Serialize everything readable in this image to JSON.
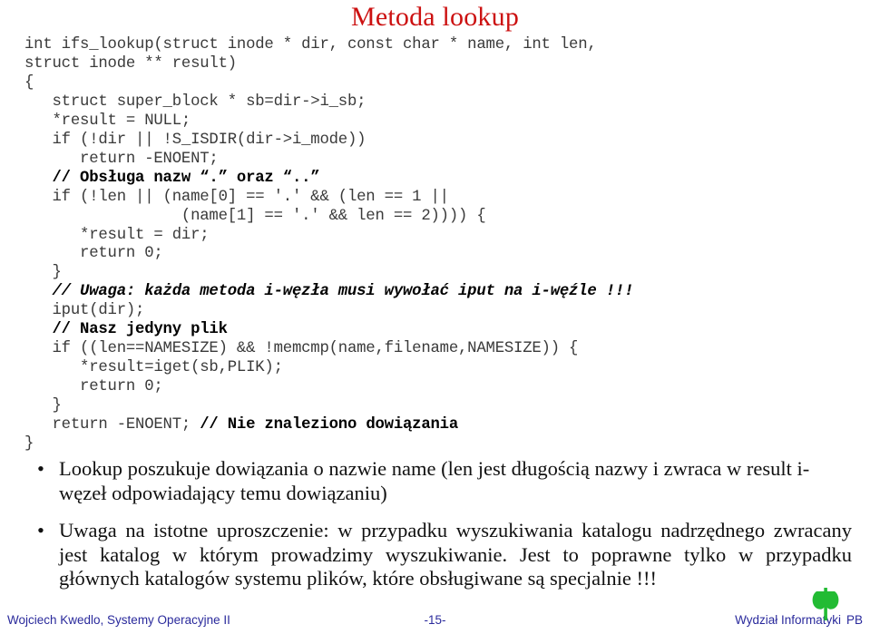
{
  "slide": {
    "title": "Metoda lookup",
    "title_color": "#CC1111",
    "bullet_glyph": "•"
  },
  "code": {
    "lines": [
      {
        "text": "int ifs_lookup(struct inode * dir, const char * name, int len,",
        "style": "plain"
      },
      {
        "text": "struct inode ** result)",
        "style": "plain"
      },
      {
        "text": "{",
        "style": "plain"
      },
      {
        "text": "   struct super_block * sb=dir->i_sb;",
        "style": "plain"
      },
      {
        "text": "   *result = NULL;",
        "style": "plain"
      },
      {
        "text": "   if (!dir || !S_ISDIR(dir->i_mode))",
        "style": "plain"
      },
      {
        "text": "      return -ENOENT;",
        "style": "plain"
      },
      {
        "text": "   // Obsługa nazw “.” oraz “..”",
        "style": "comment"
      },
      {
        "text": "   if (!len || (name[0] == '.' && (len == 1 ||",
        "style": "plain"
      },
      {
        "text": "                 (name[1] == '.' && len == 2)))) {",
        "style": "plain"
      },
      {
        "text": "      *result = dir;",
        "style": "plain"
      },
      {
        "text": "      return 0;",
        "style": "plain"
      },
      {
        "text": "   }",
        "style": "plain"
      },
      {
        "text": "   // Uwaga: każda metoda i-węzła musi wywołać iput na i-węźle !!!",
        "style": "comment-italic"
      },
      {
        "text": "   iput(dir);",
        "style": "plain"
      },
      {
        "text": "   // Nasz jedyny plik",
        "style": "comment"
      },
      {
        "text": "   if ((len==NAMESIZE) && !memcmp(name,filename,NAMESIZE)) {",
        "style": "plain"
      },
      {
        "text": "      *result=iget(sb,PLIK);",
        "style": "plain"
      },
      {
        "text": "      return 0;",
        "style": "plain"
      },
      {
        "text": "   }",
        "style": "plain"
      },
      {
        "text": "   return -ENOENT; ",
        "style": "plain",
        "tail": "// Nie znaleziono dowiązania",
        "tail_style": "comment"
      },
      {
        "text": "}",
        "style": "plain"
      }
    ]
  },
  "bullets": [
    "Lookup poszukuje dowiązania o nazwie name (len jest długością nazwy i zwraca w result i-węzeł odpowiadający temu dowiązaniu)",
    "Uwaga na istotne uproszczenie: w przypadku wyszukiwania katalogu nadrzędnego zwracany jest katalog w którym prowadzimy wyszukiwanie. Jest to poprawne tylko w przypadku głównych katalogów systemu plików, które obsługiwane są specjalnie !!!"
  ],
  "footer": {
    "left": "Wojciech Kwedlo, Systemy Operacyjne II",
    "center": "-15-",
    "faculty": "Wydział Informatyki",
    "institution": "PB",
    "text_color": "#2a2a9c",
    "logo_color": "#22BB33",
    "logo_name": "pb-phi-logo"
  }
}
